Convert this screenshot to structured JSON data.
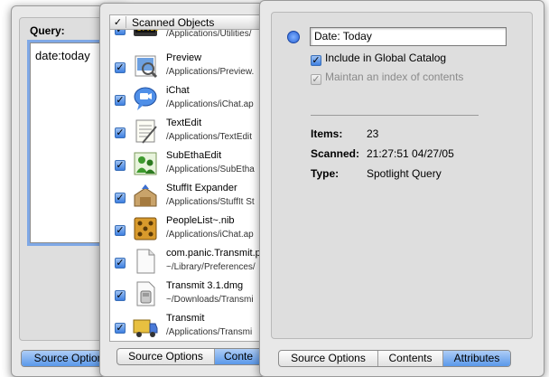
{
  "query_window": {
    "label": "Query:",
    "query_text": "date:today",
    "tabs": [
      {
        "label": "Source Options",
        "active": true
      }
    ]
  },
  "scanned_window": {
    "header_check": "✓",
    "header_title": "Scanned Objects",
    "rows": [
      {
        "name": "",
        "path": "/Applications/Utilities/",
        "icon": "console-app-icon",
        "checked": true
      },
      {
        "name": "Preview",
        "path": "/Applications/Preview.",
        "icon": "preview-app-icon",
        "checked": true
      },
      {
        "name": "iChat",
        "path": "/Applications/iChat.ap",
        "icon": "ichat-app-icon",
        "checked": true
      },
      {
        "name": "TextEdit",
        "path": "/Applications/TextEdit",
        "icon": "textedit-app-icon",
        "checked": true
      },
      {
        "name": "SubEthaEdit",
        "path": "/Applications/SubEtha",
        "icon": "subethaedit-app-icon",
        "checked": true
      },
      {
        "name": "StuffIt Expander",
        "path": "/Applications/StuffIt St",
        "icon": "stuffit-app-icon",
        "checked": true
      },
      {
        "name": "PeopleList~.nib",
        "path": "/Applications/iChat.ap",
        "icon": "nib-file-icon",
        "checked": true
      },
      {
        "name": "com.panic.Transmit.p",
        "path": "~/Library/Preferences/",
        "icon": "document-icon",
        "checked": true
      },
      {
        "name": "Transmit 3.1.dmg",
        "path": "~/Downloads/Transmi",
        "icon": "disk-image-icon",
        "checked": true
      },
      {
        "name": "Transmit",
        "path": "/Applications/Transmi",
        "icon": "transmit-app-icon",
        "checked": true
      }
    ],
    "tabs": [
      {
        "label": "Source Options",
        "active": false
      },
      {
        "label": "Conte",
        "active": true
      }
    ]
  },
  "attributes_window": {
    "name_value": "Date: Today",
    "include_global": "Include in Global Catalog",
    "maintain_index": "Maintan an index of contents",
    "items_label": "Items:",
    "items_value": "23",
    "scanned_label": "Scanned:",
    "scanned_value": "21:27:51 04/27/05",
    "type_label": "Type:",
    "type_value": "Spotlight Query",
    "tabs": [
      {
        "label": "Source Options",
        "active": false
      },
      {
        "label": "Contents",
        "active": false
      },
      {
        "label": "Attributes",
        "active": true
      }
    ]
  },
  "colors": {
    "accent": "#5a98ea",
    "focus_ring": "#7fa8e6",
    "window_bg": "#e8e8e8"
  }
}
